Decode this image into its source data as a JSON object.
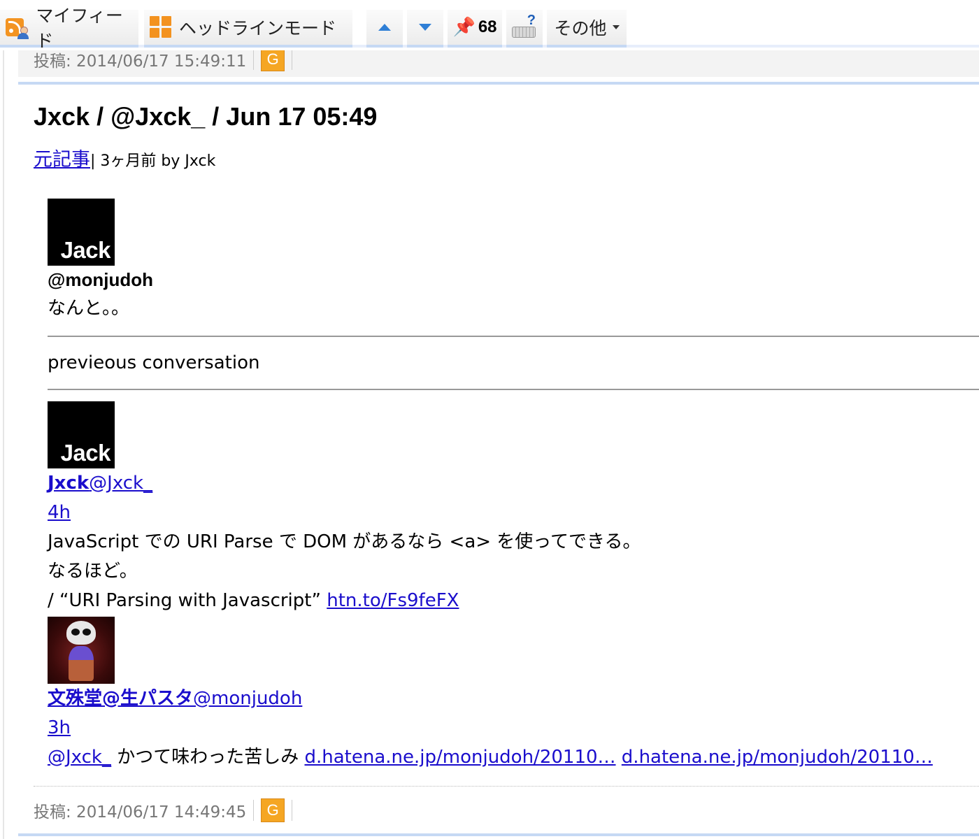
{
  "toolbar": {
    "my_feed_label": "マイフィード",
    "headline_mode_label": "ヘッドラインモード",
    "pin_count": "68",
    "other_label": "その他"
  },
  "previous_entry": {
    "posted": "投稿: 2014/06/17 15:49:11",
    "g_label": "G"
  },
  "entry": {
    "title": "Jxck / @Jxck_ / Jun 17 05:49",
    "source_link": "元記事",
    "byline": " | 3ヶ月前 by Jxck",
    "posted": "投稿: 2014/06/17 14:49:45",
    "g_label": "G"
  },
  "tweet": {
    "avatar_text": "Jack",
    "handle": "@monjudoh",
    "text": "なんと。。"
  },
  "conversation": {
    "label": "previeous conversation",
    "items": [
      {
        "avatar_text": "Jack",
        "name": "Jxck",
        "handle": "@Jxck_",
        "time": "4h",
        "line1": "JavaScript での URI Parse で DOM があるなら <a> を使ってできる。",
        "line2": "なるほど。",
        "line3_prefix": "/ “URI Parsing with Javascript” ",
        "link": "htn.to/Fs9feFX"
      },
      {
        "name": "文殊堂@生パスタ",
        "handle": "@monjudoh",
        "time": "3h",
        "mention": "@Jxck_",
        "text": " かつて味わった苦しみ ",
        "link1": "d.hatena.ne.jp/monjudoh/20110…",
        "link2": "d.hatena.ne.jp/monjudoh/20110…"
      }
    ]
  }
}
